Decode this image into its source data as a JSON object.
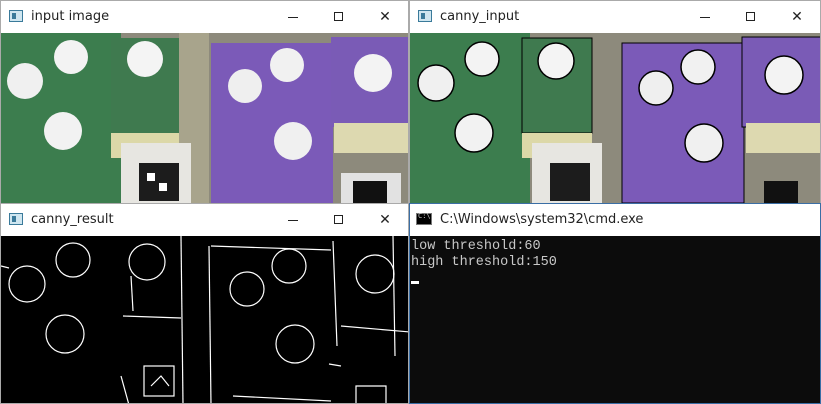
{
  "windows": {
    "input": {
      "title": "input image"
    },
    "canny_input": {
      "title": "canny_input"
    },
    "canny_result": {
      "title": "canny_result"
    },
    "cmd": {
      "title": "C:\\Windows\\system32\\cmd.exe",
      "lines": [
        "low threshold:60",
        "high threshold:150"
      ]
    }
  },
  "controls": {
    "minimize": "",
    "maximize": "",
    "close": "✕"
  },
  "colors": {
    "green_board": "#3f7a4f",
    "purple_board": "#7b5ab8",
    "ball": "#f2f2f2",
    "console_bg": "#0c0c0c"
  },
  "icons": {
    "window_icon": "app-window-icon",
    "cmd_icon": "console-icon"
  }
}
